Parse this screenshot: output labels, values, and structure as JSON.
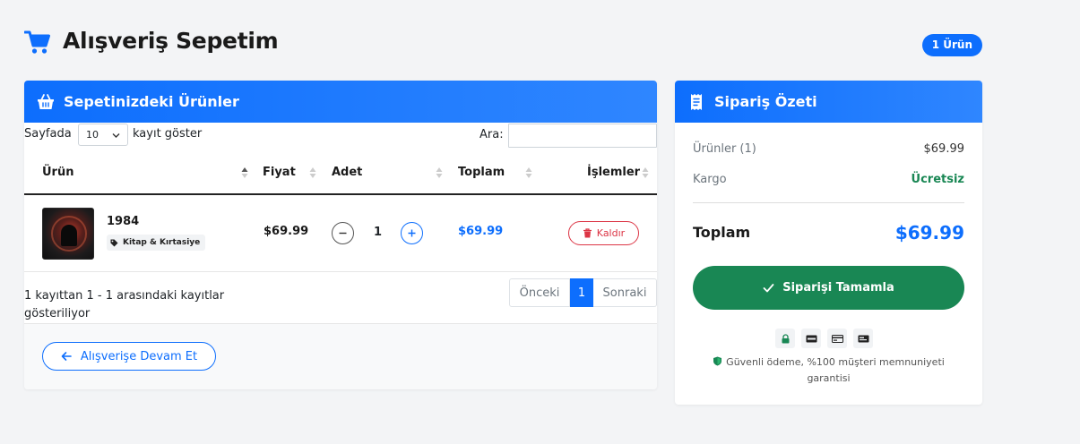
{
  "header": {
    "title": "Alışveriş Sepetim",
    "count_badge": "1 Ürün"
  },
  "cart": {
    "card_title": "Sepetinizdeki Ürünler",
    "controls": {
      "show_label": "Sayfada",
      "page_size": "10",
      "records_label": "kayıt göster",
      "search_label": "Ara:",
      "search_value": ""
    },
    "columns": [
      "Ürün",
      "Fiyat",
      "Adet",
      "Toplam",
      "İşlemler"
    ],
    "rows": [
      {
        "name": "1984",
        "category": "Kitap & Kırtasiye",
        "price": "$69.99",
        "quantity": "1",
        "total": "$69.99",
        "remove_label": "Kaldır"
      }
    ],
    "info": "1 kayıttan 1 - 1 arasındaki kayıtlar gösteriliyor",
    "pagination": {
      "prev": "Önceki",
      "page": "1",
      "next": "Sonraki"
    },
    "continue_label": "Alışverişe Devam Et"
  },
  "summary": {
    "title": "Sipariş Özeti",
    "items_label": "Ürünler (1)",
    "items_value": "$69.99",
    "shipping_label": "Kargo",
    "shipping_value": "Ücretsiz",
    "total_label": "Toplam",
    "total_value": "$69.99",
    "checkout_label": "Siparişi Tamamla",
    "payment_icons": [
      "lock-icon",
      "visa-card-icon",
      "credit-card-icon",
      "payment-card-icon"
    ],
    "secure_text": "Güvenli ödeme, %100 müşteri memnuniyeti garantisi"
  },
  "colors": {
    "primary": "#0d6efd",
    "success": "#198754",
    "danger": "#dc3545",
    "page_bg": "#f3f4f6"
  }
}
